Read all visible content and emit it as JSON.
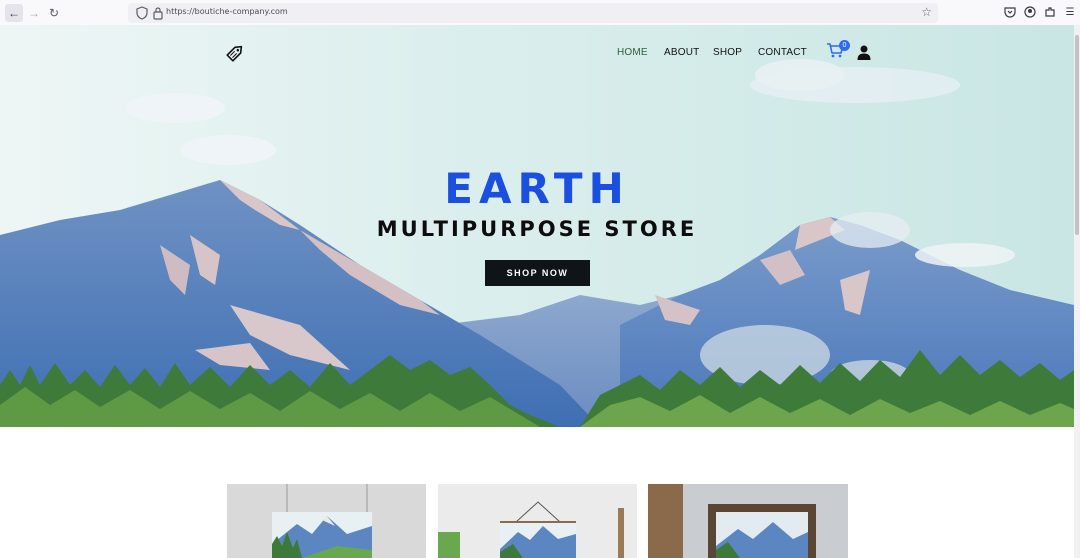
{
  "browser": {
    "url": "https://boutiche-company.com",
    "icons": [
      "back-icon",
      "forward-icon",
      "reload-icon",
      "shield-icon",
      "lock-icon",
      "bookmark-star-icon",
      "pocket-icon",
      "account-icon",
      "extensions-icon",
      "menu-icon"
    ]
  },
  "header": {
    "nav": {
      "home": "HOME",
      "about": "ABOUT",
      "shop": "SHOP",
      "contact": "CONTACT"
    },
    "cart_count": "0",
    "active_color": "#2f5f3a"
  },
  "hero": {
    "title": "EARTH",
    "subtitle": "MULTIPURPOSE STORE",
    "cta": "SHOP NOW",
    "title_color": "#1b4fe0"
  },
  "products": [
    {
      "name": "mountain-poster-card"
    },
    {
      "name": "mountain-hanging-card"
    },
    {
      "name": "mountain-frame-card"
    }
  ]
}
